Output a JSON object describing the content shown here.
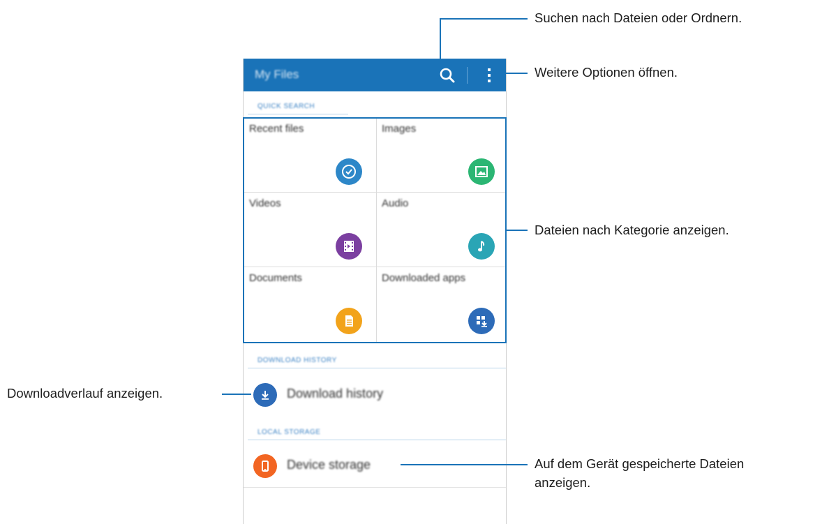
{
  "app": {
    "title": "My Files"
  },
  "sections": {
    "quick_search": "QUICK SEARCH",
    "download_history": "DOWNLOAD HISTORY",
    "local_storage": "LOCAL STORAGE"
  },
  "categories": [
    {
      "label": "Recent files",
      "icon": "clock-icon",
      "color": "#2d87c8"
    },
    {
      "label": "Images",
      "icon": "image-icon",
      "color": "#2bb673"
    },
    {
      "label": "Videos",
      "icon": "film-icon",
      "color": "#7b3fa0"
    },
    {
      "label": "Audio",
      "icon": "music-note-icon",
      "color": "#2aa5b5"
    },
    {
      "label": "Documents",
      "icon": "document-icon",
      "color": "#f2a31b"
    },
    {
      "label": "Downloaded apps",
      "icon": "apps-download-icon",
      "color": "#2d6bb8"
    }
  ],
  "list": {
    "download_history": {
      "label": "Download history",
      "icon": "download-icon",
      "color": "#2d6bb8"
    },
    "device_storage": {
      "label": "Device storage",
      "icon": "phone-icon",
      "color": "#f26522"
    }
  },
  "callouts": {
    "search": "Suchen nach Dateien oder Ordnern.",
    "more": "Weitere Optionen öffnen.",
    "categories": "Dateien nach Kategorie anzeigen.",
    "download_history": "Downloadverlauf anzeigen.",
    "device_storage_line1": "Auf dem Gerät gespeicherte Dateien",
    "device_storage_line2": "anzeigen."
  },
  "colors": {
    "accent": "#1a73b8"
  }
}
